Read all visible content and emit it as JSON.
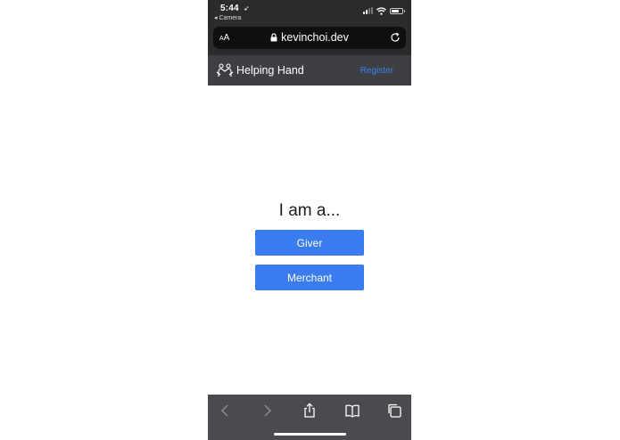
{
  "status_bar": {
    "time": "5:44",
    "back_label": "◂ Camera"
  },
  "browser": {
    "text_size_small": "A",
    "text_size_large": "A",
    "url": "kevinchoi.dev"
  },
  "navbar": {
    "brand": "Helping Hand",
    "register_label": "Register"
  },
  "main": {
    "heading": "I am a...",
    "giver_label": "Giver",
    "merchant_label": "Merchant"
  },
  "colors": {
    "accent": "#3a7cf0",
    "navbar_bg": "#3d3f42",
    "toolbar_bg": "#4a4b4e",
    "link": "#3b82f6"
  },
  "icons": {
    "status": [
      "location-arrow-icon",
      "signal-icon",
      "wifi-icon",
      "battery-icon"
    ],
    "browser": [
      "lock-icon",
      "reload-icon"
    ],
    "brand": "handshake-icon",
    "toolbar": [
      "back-icon",
      "forward-icon",
      "share-icon",
      "bookmarks-icon",
      "tabs-icon"
    ]
  }
}
